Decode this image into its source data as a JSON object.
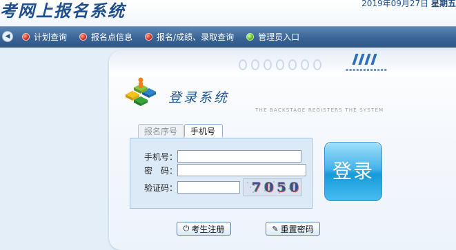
{
  "header": {
    "site_title": "考网上报名系统",
    "date": "2019年09月27日",
    "weekday": "星期五"
  },
  "nav": {
    "items": [
      {
        "label": "计划查询",
        "dot": "red"
      },
      {
        "label": "报名点信息",
        "dot": "red"
      },
      {
        "label": "报名/成绩、录取查询",
        "dot": "red"
      },
      {
        "label": "管理员入口",
        "dot": "green"
      }
    ]
  },
  "login": {
    "title": "登录系统",
    "subtitle": "THE BACKSTAGE REGISTERS THE SYSTEM",
    "tabs": {
      "serial": "报名序号",
      "phone": "手机号"
    },
    "fields": {
      "phone_label": "手机号：",
      "password_label": "密　码：",
      "captcha_label": "验证码：",
      "phone_value": "",
      "password_value": "",
      "captcha_value": ""
    },
    "captcha_text": "7050",
    "login_button": "登录",
    "register_button": "考生注册",
    "reset_button": "重置密码"
  },
  "colors": {
    "brand": "#1f4f8f",
    "nav_bg": "#3b6597",
    "login_button": "#2aa7e3",
    "panel_bg": "#f6f9fd"
  }
}
